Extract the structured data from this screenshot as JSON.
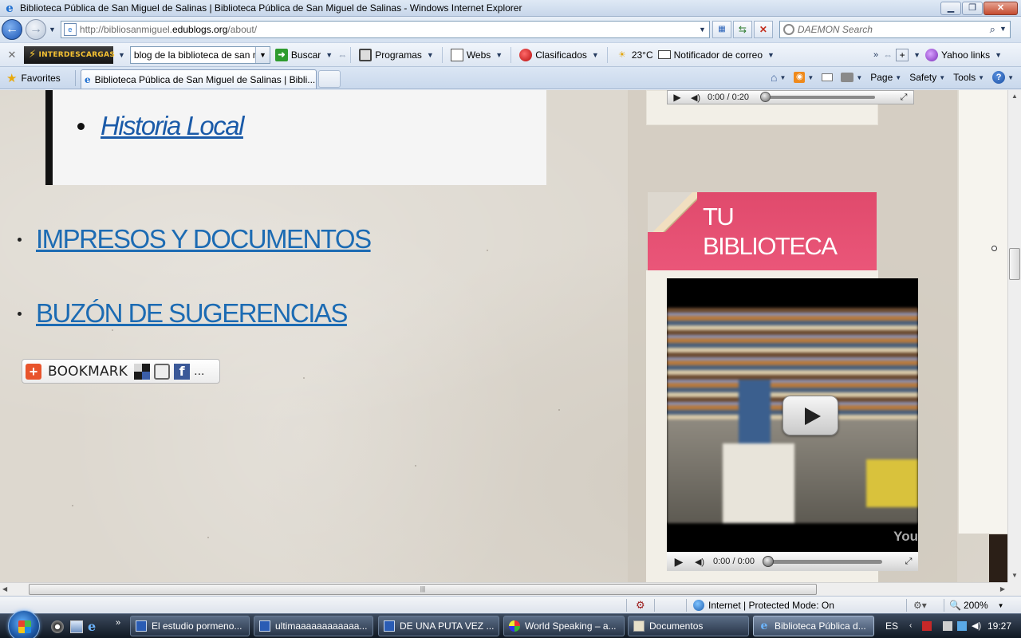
{
  "window": {
    "title": "Biblioteca Pública de San Miguel de Salinas | Biblioteca Pública de San Miguel de Salinas - Windows Internet Explorer",
    "minimize": "▁",
    "maximize": "❐",
    "close": "✕"
  },
  "address": {
    "url_prefix": "http://bibliosanmiguel.",
    "url_domain": "edublogs.org",
    "url_suffix": "/about/",
    "search_placeholder": "DAEMON Search"
  },
  "toolbar": {
    "logo_text": "INTERDESCARGAS",
    "search_value": "blog de la biblioteca de san migu",
    "buscar": "Buscar",
    "programas": "Programas",
    "webs": "Webs",
    "clasificados": "Clasificados",
    "weather": "23°C",
    "notificador": "Notificador de correo",
    "yahoo": "Yahoo links"
  },
  "tabs": {
    "favorites": "Favorites",
    "active_tab": "Biblioteca Pública de San Miguel de Salinas | Bibli...",
    "page_menu": "Page",
    "safety_menu": "Safety",
    "tools_menu": "Tools"
  },
  "content": {
    "sublist": [
      "Historia Local"
    ],
    "mainlist": [
      "IMPRESOS Y DOCUMENTOS",
      "BUZÓN DE SUGERENCIAS"
    ],
    "bookmark_label": "BOOKMARK",
    "bookmark_more": "...",
    "top_player_time": "0:00 / 0:20",
    "widget_title": "TU BIBLIOTECA",
    "video_time": "0:00 / 0:00",
    "video_brand": "You"
  },
  "status": {
    "zone": "Internet | Protected Mode: On",
    "zoom": "200%"
  },
  "taskbar": {
    "tasks": [
      "El estudio pormeno...",
      "ultimaaaaaaaaaaaa...",
      "DE UNA PUTA VEZ ...",
      "World Speaking – a...",
      "Documentos",
      "Biblioteca Pública d..."
    ],
    "lang": "ES",
    "clock": "19:27"
  },
  "colors": {
    "link": "#1c6bb3",
    "ribbon": "#e04a6c",
    "page_bg": "#ddd8cf"
  }
}
